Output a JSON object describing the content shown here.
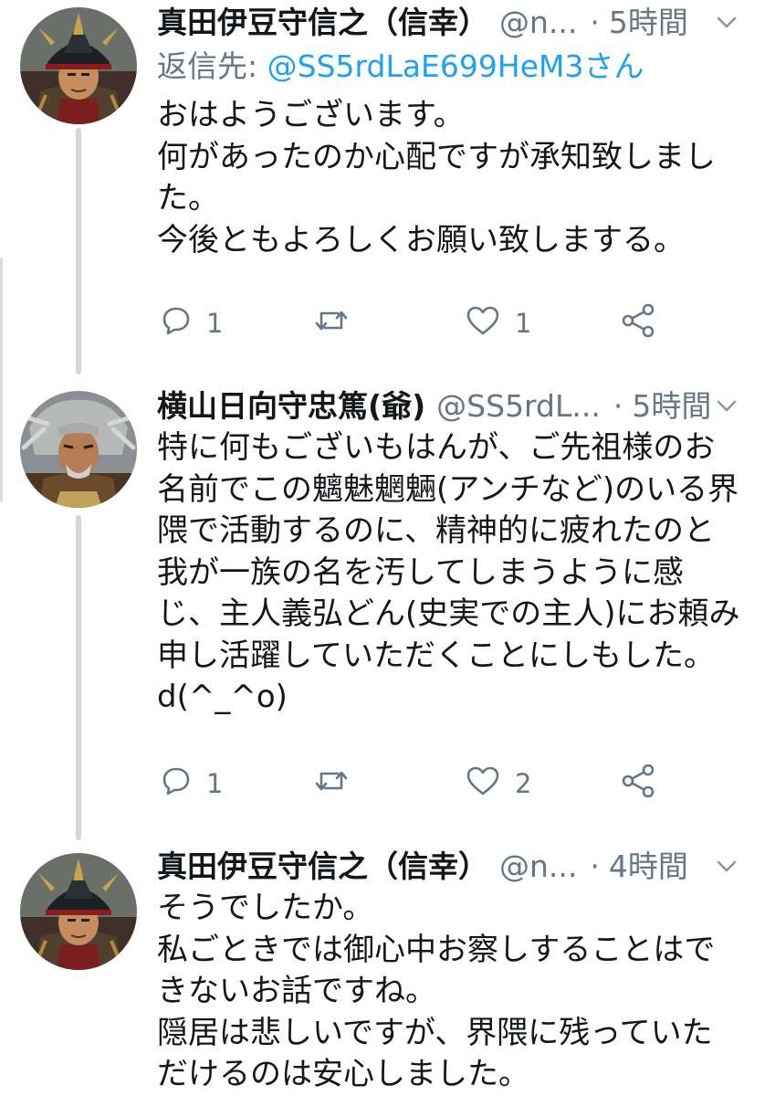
{
  "tweets": [
    {
      "name": "真田伊豆守信之（信幸）",
      "handle": "@n...",
      "dot": "·",
      "time": "5時間",
      "replying_label": "返信先:",
      "replying_to": "@SS5rdLaE699HeM3さん",
      "lines": [
        "おはようございます。",
        "何があったのか心配ですが承知致しまし",
        "た。",
        "今後ともよろしくお願い致しまする。"
      ],
      "replies": "1",
      "retweets": "",
      "likes": "1"
    },
    {
      "name": "横山日向守忠篤(爺)",
      "handle": "@SS5rdL...",
      "dot": "·",
      "time": "5時間",
      "lines": [
        "特に何もございもはんが、ご先祖様のお",
        "名前でこの魑魅魍魎(アンチなど)のいる界",
        "隈で活動するのに、精神的に疲れたのと",
        "我が一族の名を汚してしまうように感",
        "じ、主人義弘どん(史実での主人)にお頼み",
        "申し活躍していただくことにしもした。",
        "d(^_^o)"
      ],
      "replies": "1",
      "retweets": "",
      "likes": "2"
    },
    {
      "name": "真田伊豆守信之（信幸）",
      "handle": "@n...",
      "dot": "·",
      "time": "4時間",
      "lines": [
        "そうでしたか。",
        "私ごときでは御心中お察しすることはで",
        "きないお話ですね。",
        "隠居は悲しいですが、界隈に残っていた",
        "だけるのは安心しました。"
      ]
    }
  ],
  "icons": {
    "reply": "reply-icon",
    "retweet": "retweet-icon",
    "like": "like-icon",
    "share": "share-icon",
    "more": "chevron-down-icon"
  },
  "colors": {
    "text": "#14171a",
    "secondary": "#657786",
    "link": "#1da1f2",
    "thread_line": "#cfd9de"
  }
}
